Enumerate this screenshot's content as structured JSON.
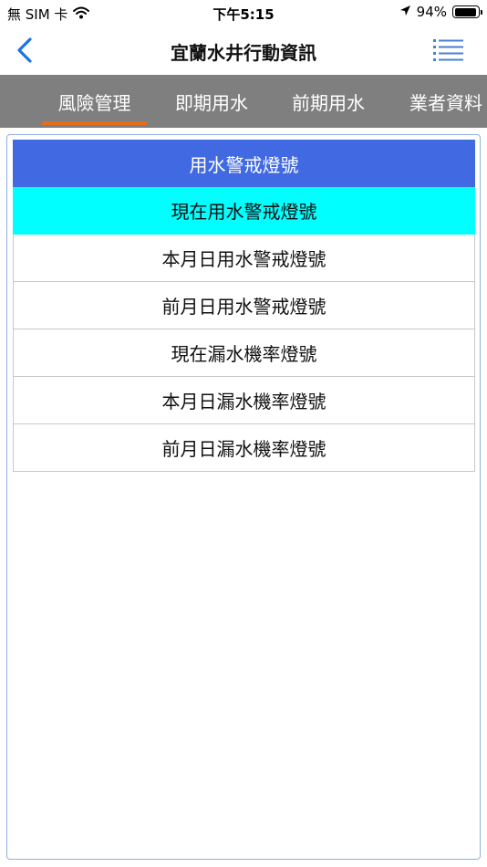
{
  "status": {
    "carrier": "無 SIM 卡",
    "time": "下午5:15",
    "battery": "94%",
    "battery_level": 0.94
  },
  "nav": {
    "title": "宜蘭水井行動資訊"
  },
  "tabs": [
    {
      "label": "風險管理",
      "active": true
    },
    {
      "label": "即期用水",
      "active": false
    },
    {
      "label": "前期用水",
      "active": false
    },
    {
      "label": "業者資料",
      "active": false
    }
  ],
  "list": {
    "header": "用水警戒燈號",
    "items": [
      {
        "label": "現在用水警戒燈號",
        "selected": true
      },
      {
        "label": "本月日用水警戒燈號",
        "selected": false
      },
      {
        "label": "前月日用水警戒燈號",
        "selected": false
      },
      {
        "label": "現在漏水機率燈號",
        "selected": false
      },
      {
        "label": "本月日漏水機率燈號",
        "selected": false
      },
      {
        "label": "前月日漏水機率燈號",
        "selected": false
      }
    ]
  },
  "colors": {
    "accent": "#4169e1",
    "selected": "#00ffff",
    "tab_bar": "#7f7f7f",
    "tab_indicator": "#e36c1d",
    "back_icon": "#1a73e8"
  }
}
